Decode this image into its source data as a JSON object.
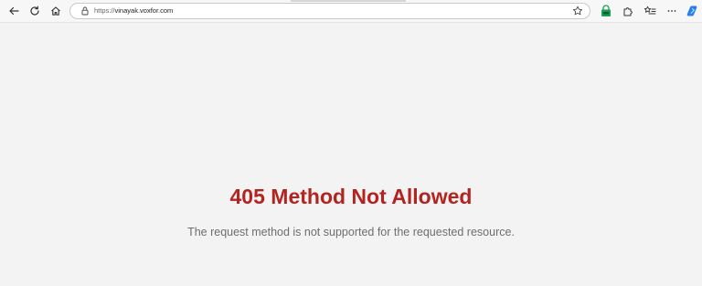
{
  "browser": {
    "url_scheme": "https://",
    "url_host": "vinayak.voxfor.com"
  },
  "page": {
    "error_title": "405 Method Not Allowed",
    "error_message": "The request method is not supported for the requested resource."
  },
  "colors": {
    "error_title": "#b3231f",
    "error_message": "#6e6e6e",
    "page_background": "#f3f3f3",
    "toolbar_background": "#f7f7f7",
    "extension_accent": "#1a9b52",
    "copilot_accent": "#2f7ce8"
  },
  "icons": {
    "back": "back-arrow-icon",
    "refresh": "refresh-icon",
    "home": "home-icon",
    "lock": "lock-icon",
    "favorite": "star-icon",
    "extension": "extension-icon",
    "puzzle": "puzzle-icon",
    "favorites_list": "favorites-list-icon",
    "more": "more-icon",
    "copilot": "copilot-icon"
  }
}
